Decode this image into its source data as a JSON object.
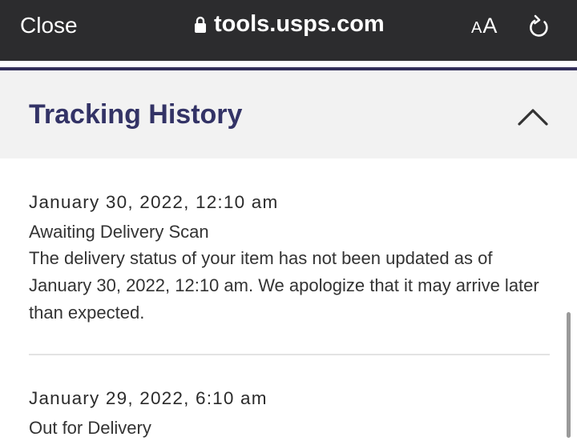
{
  "browser": {
    "close_label": "Close",
    "url": "tools.usps.com",
    "text_size_label_small": "A",
    "text_size_label_large": "A"
  },
  "section": {
    "title": "Tracking History"
  },
  "events": [
    {
      "date": "January 30, 2022, 12:10 am",
      "status": "Awaiting Delivery Scan",
      "description": "The delivery status of your item has not been updated as of January 30, 2022, 12:10 am. We apologize that it may arrive later than expected."
    },
    {
      "date": "January 29, 2022, 6:10 am",
      "status": "Out for Delivery"
    }
  ],
  "colors": {
    "topbar": "#2c2c2e",
    "heading": "#333366",
    "nav_line": "#34305a"
  },
  "icons": [
    "lock-icon",
    "reload-icon",
    "chevron-up-icon"
  ]
}
